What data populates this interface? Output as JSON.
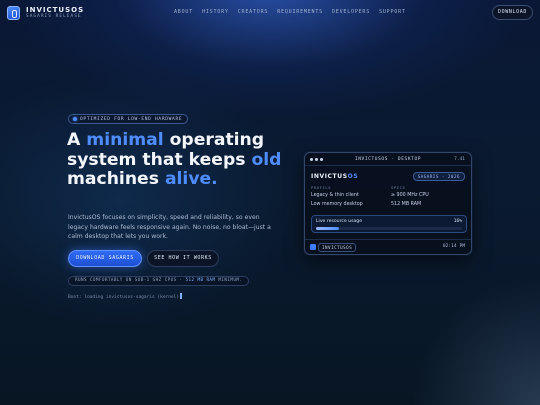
{
  "header": {
    "brand": "INVICTUSOS",
    "subtitle": "SAGARIS RELEASE",
    "nav": [
      "ABOUT",
      "HISTORY",
      "CREATORS",
      "REQUIREMENTS",
      "DEVELOPERS",
      "SUPPORT"
    ],
    "download_label": "DOWNLOAD"
  },
  "hero": {
    "badge": "OPTIMIZED FOR LOW-END HARDWARE",
    "headline": {
      "part1": "A ",
      "accent1": "minimal",
      "part2": " operating system that keeps ",
      "accent2": "old",
      "part3": " machines ",
      "accent3": "alive."
    },
    "description": "InvictusOS focuses on simplicity, speed and reliability, so even legacy hardware feels responsive again. No noise, no bloat—just a calm desktop that lets you work.",
    "primary_button": "DOWNLOAD SAGARIS",
    "secondary_button": "SEE HOW IT WORKS",
    "runs_prefix": "RUNS COMFORTABLY ON SUB-1 GHZ CPUS · ",
    "runs_highlight": "512 MB RAM",
    "runs_suffix": " MINIMUM.",
    "boot_line": "Boot: loading invictusos-sagaris (kernel)"
  },
  "desktop_window": {
    "title": "INVICTUSOS · DESKTOP",
    "version": "7.41",
    "os_name_main": "INVICTUS",
    "os_name_accent": "OS",
    "release": "SAGARIS · 2026",
    "profile_header": "PROFILE",
    "profile_lines": [
      "Legacy & thin client",
      "Low memory desktop"
    ],
    "specs_header": "SPECS",
    "specs_lines": [
      "≥ 900 MHz CPU",
      "512 MB RAM"
    ],
    "usage_label": "Live resource usage",
    "usage_value": "16%",
    "usage_fraction": 0.16,
    "taskbar_label": "INVICTUSOS",
    "clock": "02:14 PM"
  },
  "colors": {
    "accent": "#4f8dff",
    "background": "#0a1a30",
    "primary_button": "#2f6cf5"
  },
  "icons": {
    "logo": "invictus-logo-icon",
    "badge_dot": "status-dot-icon",
    "task_icon": "app-launcher-icon"
  }
}
